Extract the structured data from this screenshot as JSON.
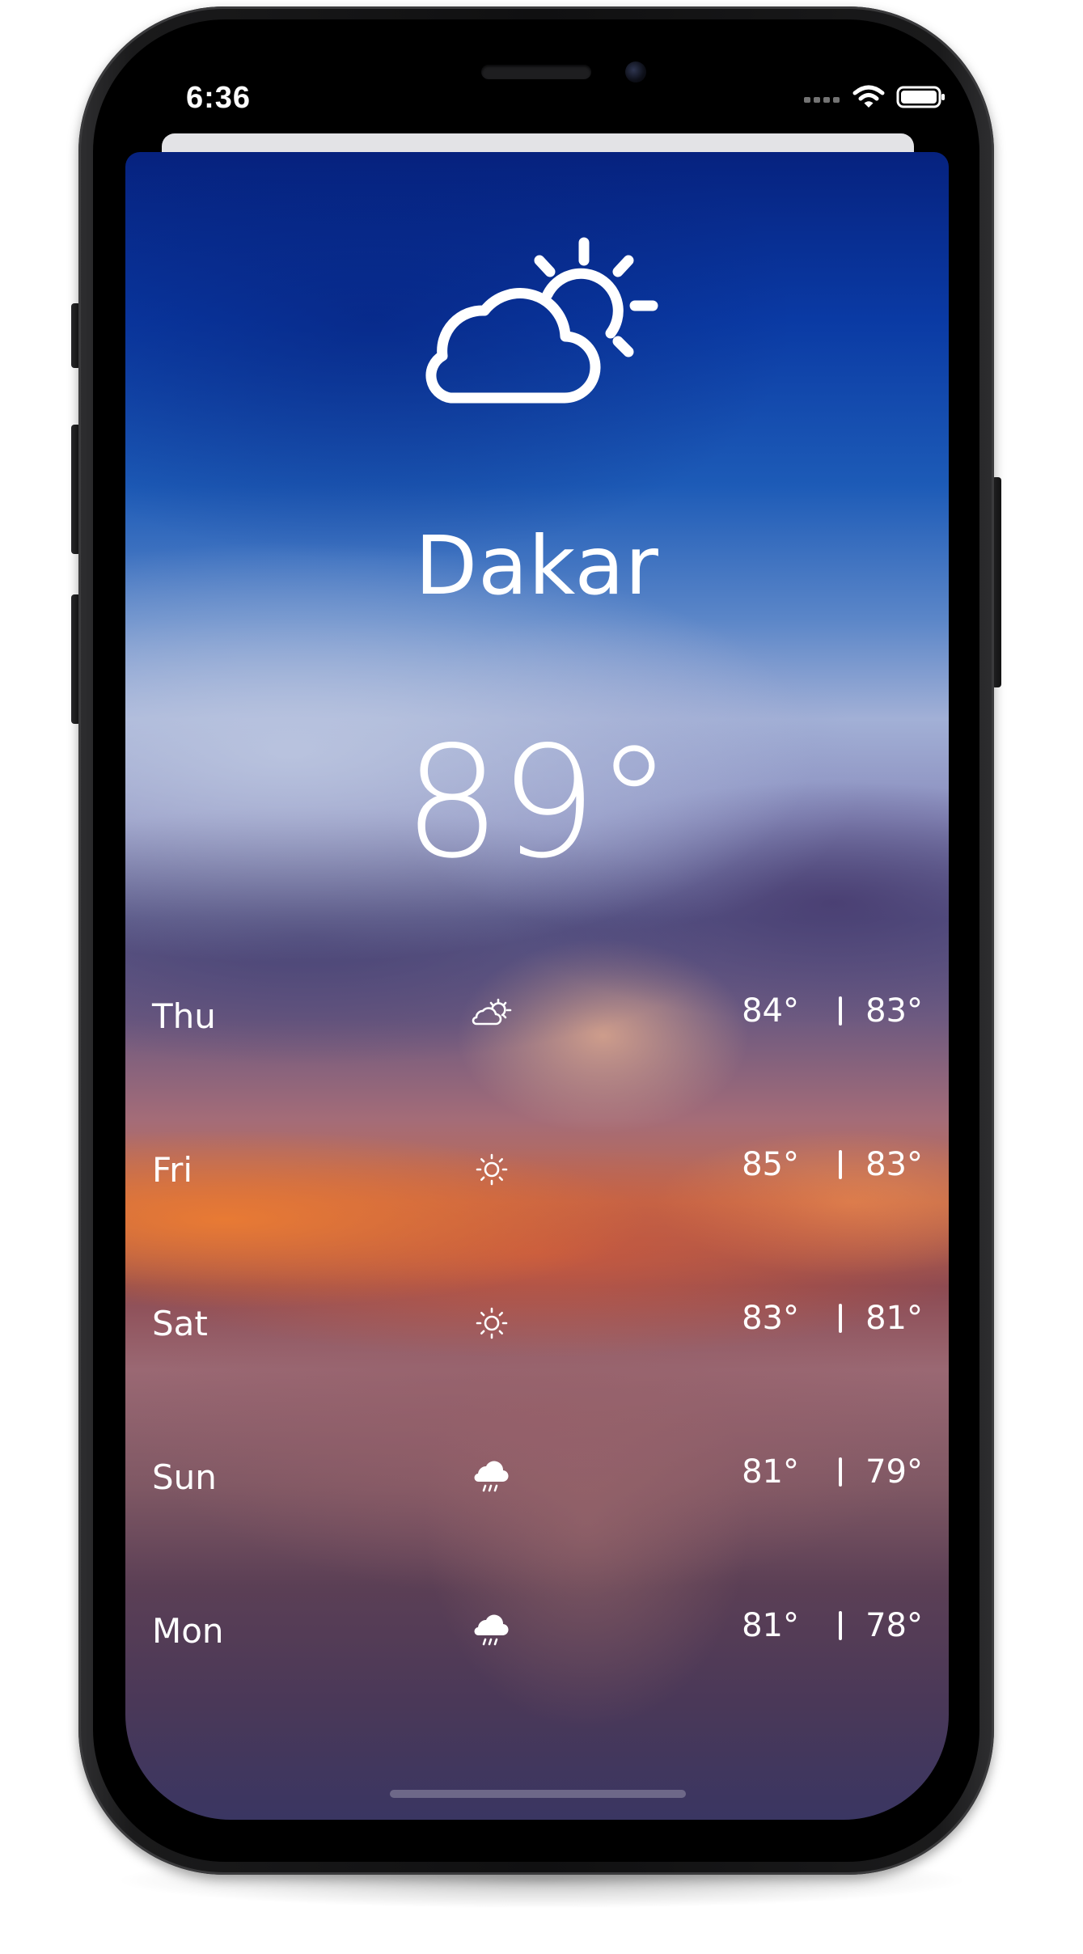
{
  "status_bar": {
    "time": "6:36",
    "icons": [
      "cellular-signal-icon",
      "wifi-icon",
      "battery-icon"
    ]
  },
  "weather": {
    "condition_icon": "partly-cloudy-day-icon",
    "city": "Dakar",
    "current_temperature": "89°"
  },
  "forecast": [
    {
      "day": "Thu",
      "icon": "partly-cloudy-day-icon",
      "high": "84°",
      "low": "83°"
    },
    {
      "day": "Fri",
      "icon": "sun-icon",
      "high": "85°",
      "low": "83°"
    },
    {
      "day": "Sat",
      "icon": "sun-icon",
      "high": "83°",
      "low": "81°"
    },
    {
      "day": "Sun",
      "icon": "cloud-rain-icon",
      "high": "81°",
      "low": "79°"
    },
    {
      "day": "Mon",
      "icon": "cloud-rain-icon",
      "high": "81°",
      "low": "78°"
    }
  ],
  "colors": {
    "text": "#ffffff",
    "sky_top": "#06227f",
    "sunset_orange": "#e87a34",
    "dusk_purple": "#3a3662"
  }
}
